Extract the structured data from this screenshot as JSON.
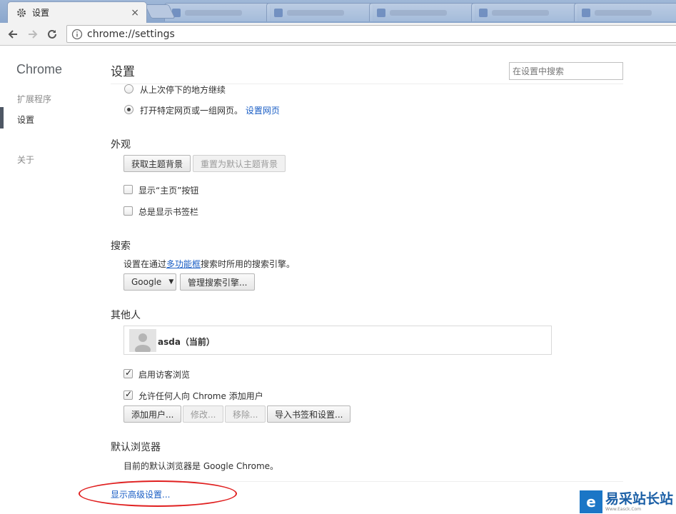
{
  "tab": {
    "title": "设置",
    "close": "×"
  },
  "toolbar": {
    "url": "chrome://settings"
  },
  "sidebar": {
    "title": "Chrome",
    "items": [
      {
        "label": "扩展程序"
      },
      {
        "label": "设置"
      },
      {
        "label": "关于"
      }
    ]
  },
  "header": {
    "title": "设置",
    "search_placeholder": "在设置中搜索"
  },
  "startup": {
    "option_continue": "从上次停下的地方继续",
    "option_specific": "打开特定网页或一组网页。",
    "set_pages_link": "设置网页"
  },
  "appearance": {
    "title": "外观",
    "get_themes": "获取主题背景",
    "reset_theme": "重置为默认主题背景",
    "show_home": "显示“主页”按钮",
    "show_bookmarks": "总是显示书签栏"
  },
  "search": {
    "title": "搜索",
    "desc_prefix": "设置在通过",
    "desc_link": "多功能框",
    "desc_suffix": "搜索时所用的搜索引擎。",
    "engine": "Google",
    "manage": "管理搜索引擎..."
  },
  "people": {
    "title": "其他人",
    "profile_name": "asda（当前）",
    "guest_browsing": "启用访客浏览",
    "let_anyone_add": "允许任何人向 Chrome 添加用户",
    "add_user": "添加用户...",
    "edit": "修改...",
    "remove": "移除...",
    "import": "导入书签和设置..."
  },
  "default_browser": {
    "title": "默认浏览器",
    "status": "目前的默认浏览器是 Google Chrome。"
  },
  "advanced_link": "显示高级设置...",
  "watermark": {
    "logo": "e",
    "main": "易采站长站",
    "sub": "Www.Easck.Com"
  }
}
